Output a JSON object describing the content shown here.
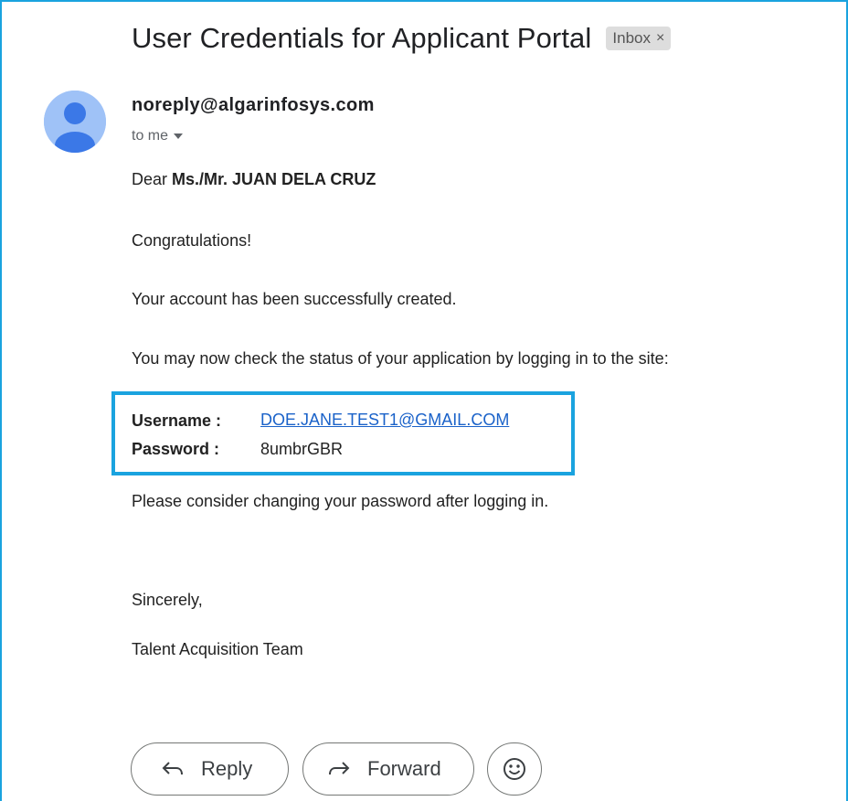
{
  "email": {
    "subject": "User Credentials for Applicant Portal",
    "label_chip": "Inbox",
    "label_close": "×",
    "sender": "noreply@algarinfosys.com",
    "recipient": "to me"
  },
  "body": {
    "greeting_prefix": "Dear ",
    "greeting_name": "Ms./Mr. JUAN DELA CRUZ",
    "congrats": "Congratulations!",
    "account_created": "Your account has been successfully created.",
    "check_status": "You may now check the status of your application by logging in to the site:",
    "username_label": "Username :",
    "username_value": "DOE.JANE.TEST1@GMAIL.COM",
    "password_label": "Password :",
    "password_value": "8umbrGBR",
    "change_password": "Please consider changing your password after logging in.",
    "closing": "Sincerely,",
    "signature": "Talent Acquisition Team"
  },
  "actions": {
    "reply_label": "Reply",
    "forward_label": "Forward"
  },
  "icons": {
    "avatar": "person-avatar-icon",
    "caret": "caret-down-icon",
    "reply": "reply-arrow-icon",
    "forward": "forward-arrow-icon",
    "emoji": "smiley-icon"
  },
  "colors": {
    "highlight": "#1aa3df",
    "link": "#1a62c9",
    "avatar_bg": "#9fc2f7",
    "avatar_fg": "#3b78e7"
  }
}
